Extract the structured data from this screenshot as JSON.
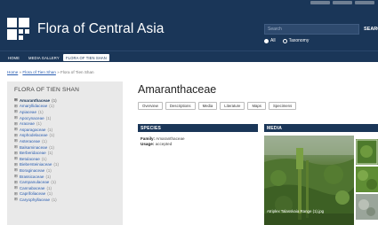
{
  "header": {
    "site_title": "Flora of Central Asia",
    "search_placeholder": "Search",
    "search_button": "SEARC",
    "radios": [
      {
        "label": "All",
        "selected": true
      },
      {
        "label": "Taxonomy",
        "selected": false
      }
    ]
  },
  "nav": {
    "tabs": [
      {
        "label": "HOME",
        "active": false
      },
      {
        "label": "MEDIA GALLERY",
        "active": false
      },
      {
        "label": "FLORA OF TIEN SHAN",
        "active": true
      }
    ]
  },
  "breadcrumb": {
    "home": "Home",
    "sep1": " » ",
    "flora": "Flora of Tien Shan",
    "sep2": " » ",
    "current": "Flora of Tien Shan"
  },
  "sidebar": {
    "title": "FLORA OF TIEN SHAN",
    "families": [
      {
        "name": "Amaranthaceae",
        "count": "(1)",
        "current": true
      },
      {
        "name": "Amaryllidaceae",
        "count": "(1)",
        "current": false
      },
      {
        "name": "Apiaceae",
        "count": "(1)",
        "current": false
      },
      {
        "name": "Apocynaceae",
        "count": "(1)",
        "current": false
      },
      {
        "name": "Araceae",
        "count": "(1)",
        "current": false
      },
      {
        "name": "Asparagaceae",
        "count": "(1)",
        "current": false
      },
      {
        "name": "Asphodelaceae",
        "count": "(1)",
        "current": false
      },
      {
        "name": "Asteraceae",
        "count": "(1)",
        "current": false
      },
      {
        "name": "Balsaminaceae",
        "count": "(1)",
        "current": false
      },
      {
        "name": "Berberidaceae",
        "count": "(1)",
        "current": false
      },
      {
        "name": "Betulaceae",
        "count": "(1)",
        "current": false
      },
      {
        "name": "Biebersteiniaceae",
        "count": "(1)",
        "current": false
      },
      {
        "name": "Boraginaceae",
        "count": "(1)",
        "current": false
      },
      {
        "name": "Brassicaceae",
        "count": "(1)",
        "current": false
      },
      {
        "name": "Campanulaceae",
        "count": "(1)",
        "current": false
      },
      {
        "name": "Cannabaceae",
        "count": "(1)",
        "current": false
      },
      {
        "name": "Caprifoliaceae",
        "count": "(1)",
        "current": false
      },
      {
        "name": "Caryophyllaceae",
        "count": "(1)",
        "current": false
      }
    ]
  },
  "main": {
    "title": "Amaranthaceae",
    "tabs": [
      "Overview",
      "Descriptions",
      "Media",
      "Literature",
      "Maps",
      "Specimens"
    ]
  },
  "species": {
    "heading": "SPECIES",
    "family_label": "Family:",
    "family_value": "Amaranthaceae",
    "usage_label": "Usage:",
    "usage_value": "accepted"
  },
  "media": {
    "heading": "MEDIA",
    "caption": "Atriplex Talasskaia Range (1).jpg"
  },
  "colors": {
    "header_bg": "#1a3658",
    "link": "#2a5db0",
    "sidebar_bg": "#e9e9e9"
  }
}
